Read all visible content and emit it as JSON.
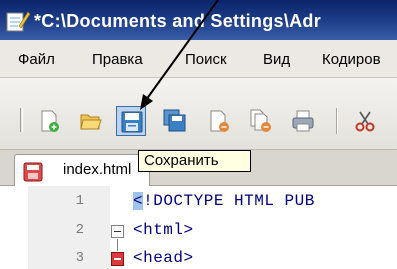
{
  "window": {
    "title": "*C:\\Documents and Settings\\Adr"
  },
  "menu": {
    "items": [
      "Файл",
      "Правка",
      "Поиск",
      "Вид",
      "Кодиров"
    ]
  },
  "toolbar": {
    "buttons": [
      "new-file-icon",
      "open-folder-icon",
      "save-icon",
      "save-all-icon",
      "close-icon",
      "close-all-icon",
      "print-icon",
      "cut-icon"
    ],
    "active": "save-icon",
    "tooltip": "Сохранить"
  },
  "tab": {
    "label": "index.html"
  },
  "editor": {
    "lines": [
      {
        "number": "1",
        "text": "<!DOCTYPE HTML PUB"
      },
      {
        "number": "2",
        "text": "<html>"
      },
      {
        "number": "3",
        "text": "<head>"
      }
    ]
  },
  "colors": {
    "title_bar": "#0a246a",
    "selection": "#9fc3ea",
    "tooltip_bg": "#ffffe1",
    "code_text": "#000080"
  }
}
